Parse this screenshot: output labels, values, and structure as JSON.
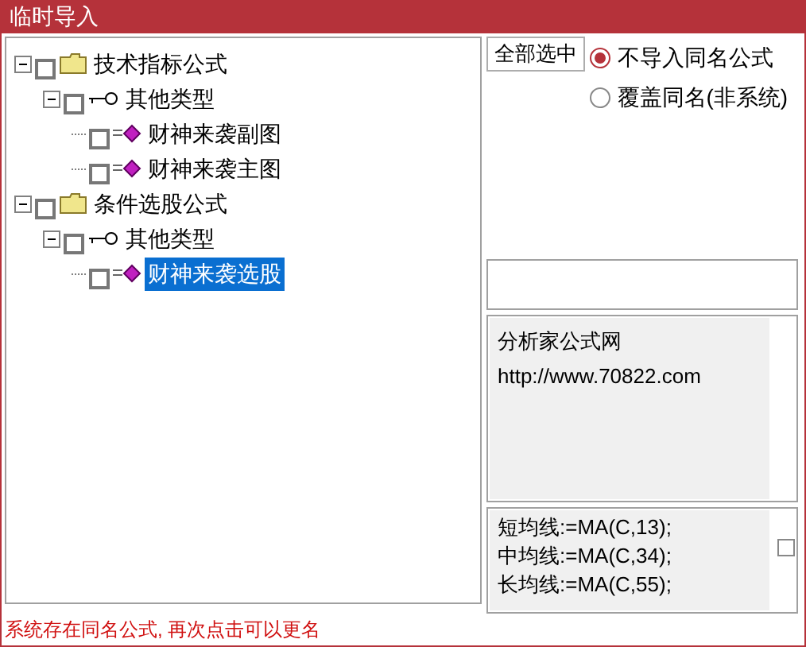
{
  "window": {
    "title": "临时导入"
  },
  "tree": [
    {
      "label": "技术指标公式",
      "kind": "folder",
      "checked": false,
      "expanded": true,
      "selected": false,
      "children": [
        {
          "label": "其他类型",
          "kind": "type",
          "checked": false,
          "expanded": true,
          "selected": false,
          "children": [
            {
              "label": "财神来袭副图",
              "kind": "formula",
              "checked": false,
              "selected": false
            },
            {
              "label": "财神来袭主图",
              "kind": "formula",
              "checked": false,
              "selected": false
            }
          ]
        }
      ]
    },
    {
      "label": "条件选股公式",
      "kind": "folder",
      "checked": false,
      "expanded": true,
      "selected": false,
      "children": [
        {
          "label": "其他类型",
          "kind": "type",
          "checked": false,
          "expanded": true,
          "selected": false,
          "children": [
            {
              "label": "财神来袭选股",
              "kind": "formula",
              "checked": false,
              "selected": true
            }
          ]
        }
      ]
    }
  ],
  "select_all_button": "全部选中",
  "options": [
    {
      "label": "不导入同名公式",
      "selected": true
    },
    {
      "label": "覆盖同名(非系统)",
      "selected": false
    }
  ],
  "description": [
    "分析家公式网",
    "http://www.70822.com"
  ],
  "code_lines": [
    "短均线:=MA(C,13);",
    "中均线:=MA(C,34);",
    "长均线:=MA(C,55);"
  ],
  "code_checkbox": {
    "checked": false
  },
  "status": "系统存在同名公式, 再次点击可以更名"
}
